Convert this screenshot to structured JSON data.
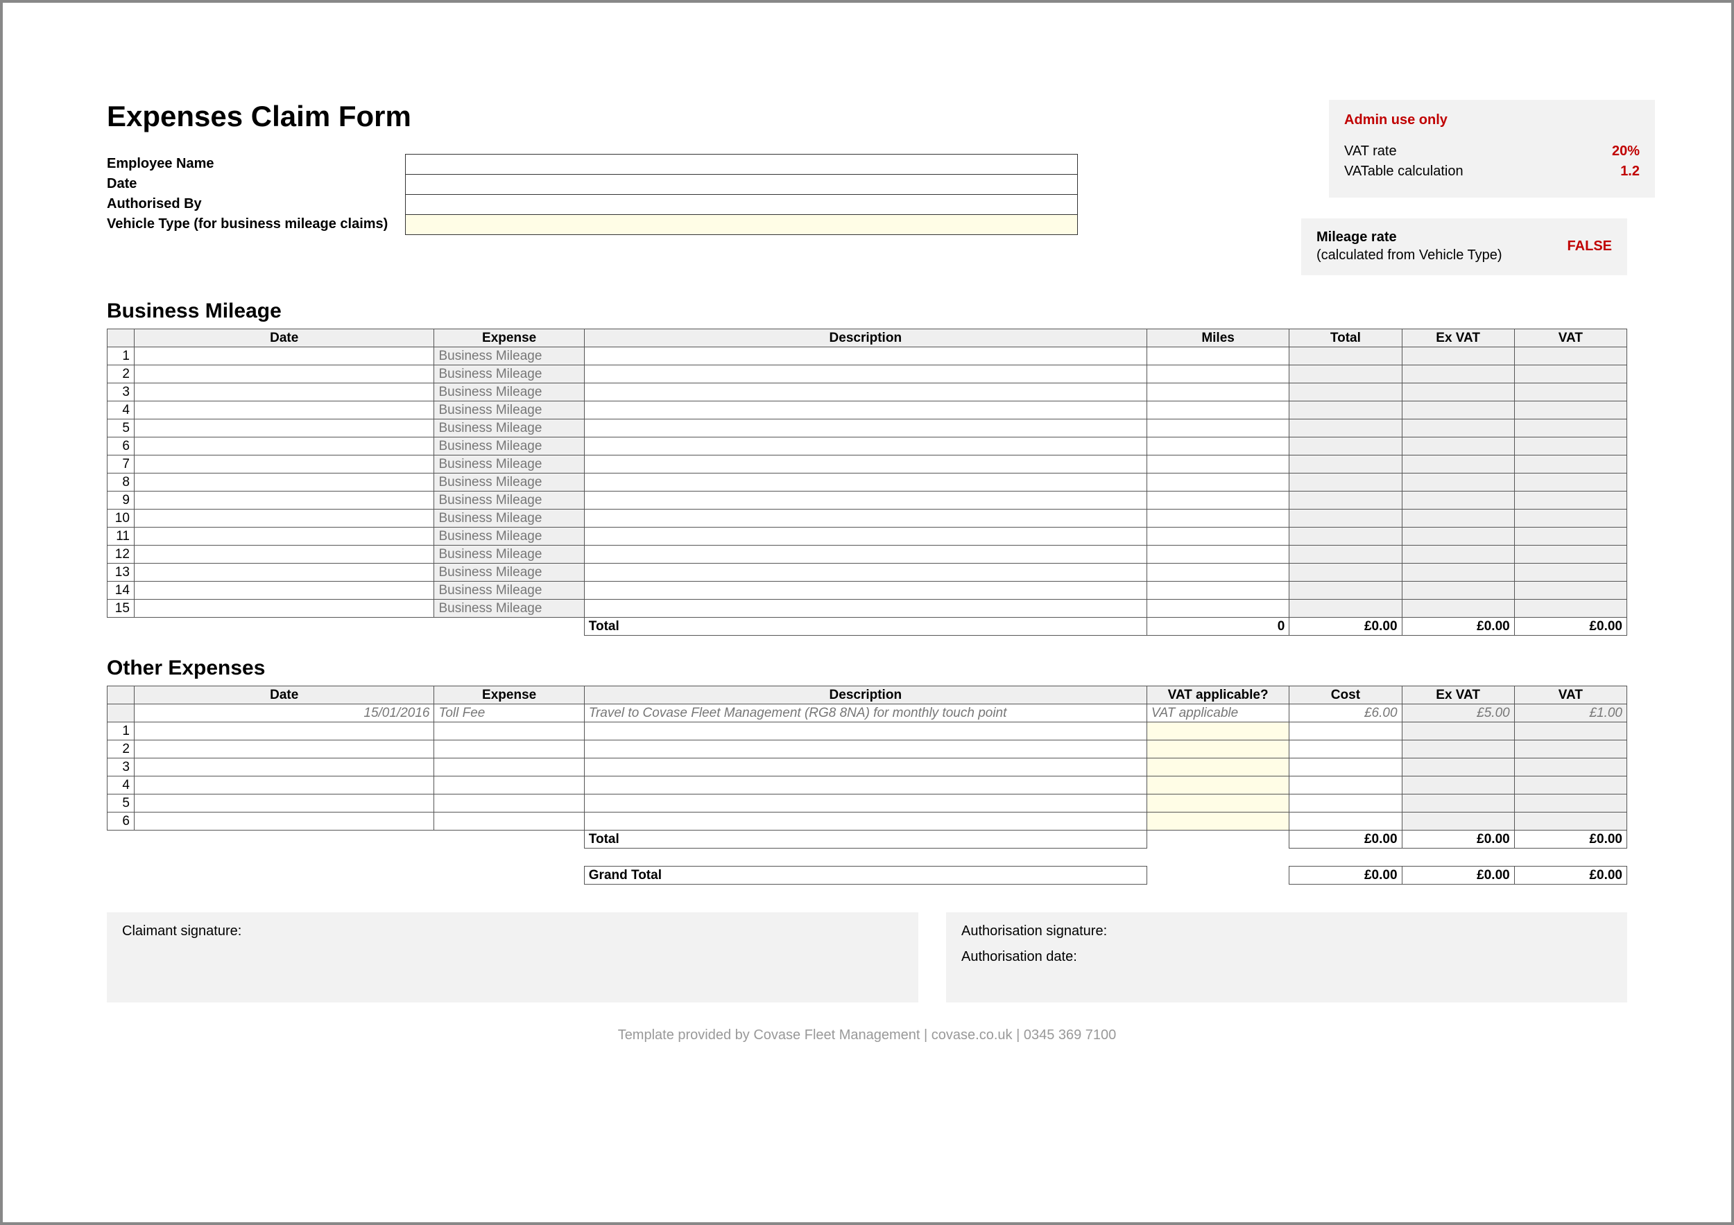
{
  "title": "Expenses Claim Form",
  "info": {
    "employee_label": "Employee Name",
    "date_label": "Date",
    "authorised_label": "Authorised By",
    "vehicle_label": "Vehicle Type (for business mileage claims)"
  },
  "admin": {
    "heading": "Admin use only",
    "vat_rate_label": "VAT rate",
    "vat_rate_value": "20%",
    "vatable_label": "VATable calculation",
    "vatable_value": "1.2",
    "mileage_label": "Mileage rate",
    "mileage_sub": "(calculated from Vehicle Type)",
    "mileage_value": "FALSE"
  },
  "business": {
    "heading": "Business Mileage",
    "cols": {
      "date": "Date",
      "expense": "Expense",
      "description": "Description",
      "miles": "Miles",
      "total": "Total",
      "exvat": "Ex VAT",
      "vat": "VAT"
    },
    "default_expense": "Business Mileage",
    "rows": 15,
    "totals": {
      "label": "Total",
      "miles": "0",
      "total": "£0.00",
      "exvat": "£0.00",
      "vat": "£0.00"
    }
  },
  "other": {
    "heading": "Other Expenses",
    "cols": {
      "date": "Date",
      "expense": "Expense",
      "description": "Description",
      "vat_applicable": "VAT applicable?",
      "cost": "Cost",
      "exvat": "Ex VAT",
      "vat": "VAT"
    },
    "example": {
      "date": "15/01/2016",
      "expense": "Toll Fee",
      "description": "Travel to Covase Fleet Management (RG8 8NA) for monthly touch point",
      "vat_applicable": "VAT applicable",
      "cost": "£6.00",
      "exvat": "£5.00",
      "vat": "£1.00"
    },
    "rows": 6,
    "totals": {
      "label": "Total",
      "cost": "£0.00",
      "exvat": "£0.00",
      "vat": "£0.00"
    },
    "grand": {
      "label": "Grand Total",
      "cost": "£0.00",
      "exvat": "£0.00",
      "vat": "£0.00"
    }
  },
  "signatures": {
    "claimant": "Claimant signature:",
    "auth_sig": "Authorisation signature:",
    "auth_date": "Authorisation date:"
  },
  "footer": "Template provided by Covase Fleet Management | covase.co.uk | 0345 369 7100"
}
